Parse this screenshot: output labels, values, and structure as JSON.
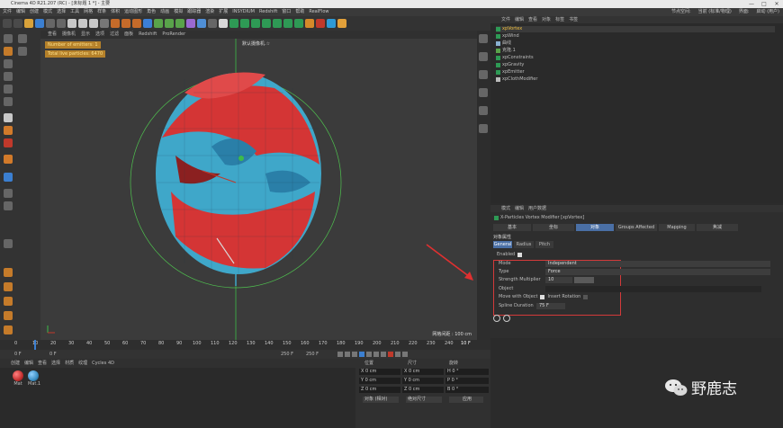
{
  "window": {
    "title": "Cinema 4D R21.207 (RC) - [未标题 1 *] - 主要",
    "controls": [
      "—",
      "□",
      "✕"
    ]
  },
  "menubar": {
    "items": [
      "文件",
      "编辑",
      "创建",
      "模式",
      "选择",
      "工具",
      "网格",
      "样条",
      "体积",
      "运动图形",
      "角色",
      "动画",
      "模拟",
      "跟踪器",
      "渲染",
      "扩展",
      "INSYDIUM",
      "Redshift",
      "窗口",
      "帮助",
      "RealFlow"
    ],
    "right_items": [
      "节点空间:",
      "当前 (标准/物理)",
      "界面:",
      "启动 (用户)"
    ]
  },
  "viewport": {
    "menu": [
      "查看",
      "摄像机",
      "显示",
      "选项",
      "过滤",
      "面板",
      "Redshift",
      "ProRender"
    ],
    "camera_label": "默认摄像机.☆",
    "hud": {
      "emitters": "Number of emitters: 1",
      "particles": "Total live particles: 6470"
    },
    "grid_info": "网格间距 : 100 cm",
    "colors": {
      "cloth_red": "#d43535",
      "cloth_blue": "#3fa7c9",
      "bg": "#3b3b3b"
    }
  },
  "objects": {
    "menu": [
      "文件",
      "编辑",
      "查看",
      "对象",
      "标签",
      "书签"
    ],
    "items": [
      {
        "name": "xpVortex",
        "selected": true
      },
      {
        "name": "xpWind",
        "selected": false
      },
      {
        "name": "曲线",
        "selected": false
      },
      {
        "name": "克隆.1",
        "selected": false
      },
      {
        "name": "xpConstraints",
        "selected": false
      },
      {
        "name": "xpGravity",
        "selected": false
      },
      {
        "name": "xpEmitter",
        "selected": false
      },
      {
        "name": "xpClothModifier",
        "selected": false
      }
    ]
  },
  "attributes": {
    "menu": [
      "模式",
      "编辑",
      "用户数据"
    ],
    "header": "X-Particles Vortex Modifier [xpVortex]",
    "tabs": [
      "基本",
      "坐标",
      "对象",
      "Groups Affected",
      "Mapping",
      "焦减"
    ],
    "active_tab": "对象",
    "section_title": "对象属性",
    "subtabs": [
      "General",
      "Radius",
      "Pitch"
    ],
    "rows": {
      "enabled": "Enabled",
      "mode_label": "Mode",
      "mode_value": "Independent",
      "type_label": "Type",
      "type_value": "Force",
      "strength_label": "Strength Multiplier",
      "strength_value": "10",
      "object_label": "Object",
      "move_label": "Move with Object",
      "insert_label": "Insert Rotation",
      "spline_label": "Spline Duration",
      "spline_value": "75 F"
    }
  },
  "timeline": {
    "ticks": [
      "0",
      "10",
      "20",
      "30",
      "40",
      "50",
      "60",
      "70",
      "80",
      "90",
      "100",
      "110",
      "120",
      "130",
      "140",
      "150",
      "160",
      "170",
      "180",
      "190",
      "200",
      "210",
      "220",
      "230",
      "240",
      "250"
    ],
    "current_frame": "10 F",
    "start": "0 F",
    "start2": "0 F",
    "end": "250 F",
    "end2": "250 F"
  },
  "materials": {
    "menu": [
      "创建",
      "编辑",
      "查看",
      "选择",
      "材质",
      "纹理",
      "Cycles 4D"
    ],
    "items": [
      {
        "name": "Mat",
        "color": "#c53030"
      },
      {
        "name": "Mat.1",
        "color": "#3c8fc4"
      }
    ]
  },
  "coords": {
    "headers": [
      "位置",
      "尺寸",
      "旋转"
    ],
    "pos": [
      "X 0 cm",
      "Y 0 cm",
      "Z 0 cm"
    ],
    "size": [
      "X 0 cm",
      "Y 0 cm",
      "Z 0 cm"
    ],
    "rot": [
      "H 0 °",
      "P 0 °",
      "B 0 °"
    ],
    "mode1": "对象 (相对)",
    "mode2": "绝对尺寸",
    "apply": "应用"
  },
  "watermark": "野鹿志"
}
